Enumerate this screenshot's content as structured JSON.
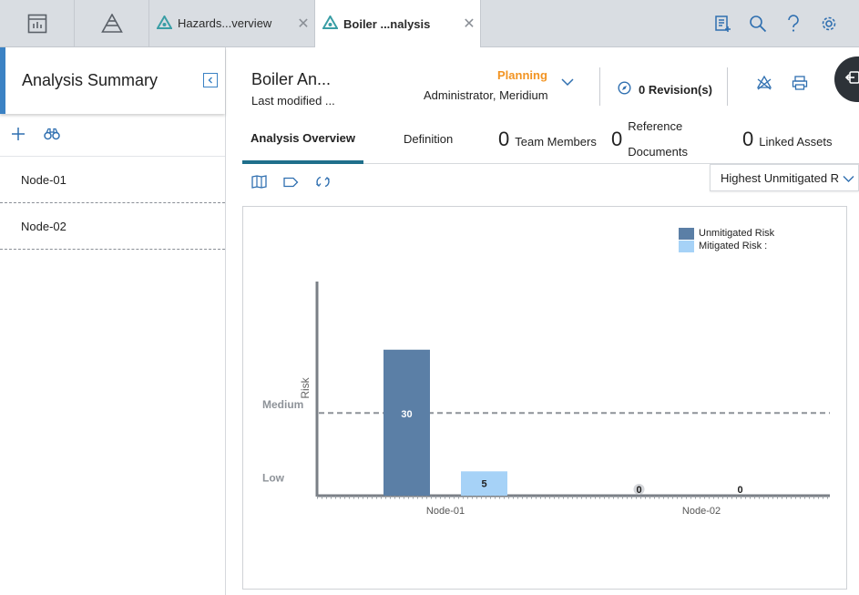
{
  "topbar": {
    "tabs": [
      {
        "label": "Hazards...verview",
        "icon": "hazop-triangle-icon"
      },
      {
        "label": "Boiler ...nalysis",
        "icon": "hazop-triangle-icon"
      }
    ],
    "tools": [
      "report-add-icon",
      "search-icon",
      "help-icon",
      "gear-icon"
    ]
  },
  "left_panel": {
    "title": "Analysis Summary",
    "nodes": [
      "Node-01",
      "Node-02"
    ]
  },
  "header": {
    "title": "Boiler An...",
    "subtitle": "Last modified ...",
    "state": "Planning",
    "owner": "Administrator, Meridium",
    "revisions": "0 Revision(s)"
  },
  "subtabs": {
    "overview": "Analysis Overview",
    "definition": "Definition",
    "team_count": "0",
    "team_label": "Team Members",
    "ref_count": "0",
    "ref_label_1": "Reference",
    "ref_label_2": "Documents",
    "assets_count": "0",
    "assets_label": "Linked Assets"
  },
  "risk_dropdown": "Highest Unmitigated R",
  "colors": {
    "accent": "#3b82c4",
    "state": "#f29423",
    "unmitigated": "#5b7fa6",
    "mitigated": "#a6d2f7"
  },
  "chart_data": {
    "type": "bar",
    "categories": [
      "Node-01",
      "Node-02"
    ],
    "series": [
      {
        "name": "Unmitigated Risk",
        "values": [
          30,
          0
        ]
      },
      {
        "name": "Mitigated Risk :",
        "values": [
          5,
          0
        ]
      }
    ],
    "ylabel": "Risk",
    "xlabel": "",
    "ylim": [
      0,
      44
    ],
    "reference_lines": [
      {
        "label": "Medium",
        "value": 17
      },
      {
        "label": "Low",
        "value": 2
      }
    ],
    "legend": "top-right"
  }
}
